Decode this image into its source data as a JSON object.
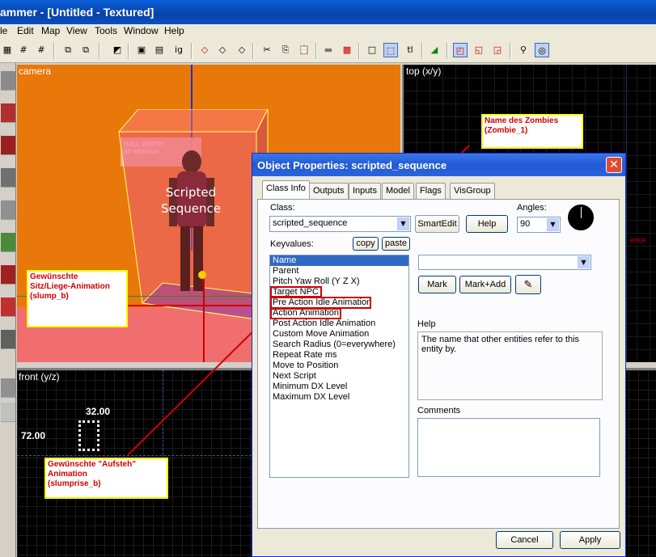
{
  "app": {
    "title": "ammer - [Untitled - Textured]"
  },
  "menu": [
    "le",
    "Edit",
    "Map",
    "View",
    "Tools",
    "Window",
    "Help"
  ],
  "toolbar": {
    "ig_label": "ig",
    "tl_label": "tl"
  },
  "viewports": {
    "camera": {
      "label": "camera",
      "scripted_text": "Scripted\nSequence",
      "sign_text": "HALL WIDTH\n84 minimum"
    },
    "top": {
      "label": "top (x/y)",
      "fragment": "ence"
    },
    "front": {
      "label": "front (y/z)",
      "width_dim": "32.00",
      "height_dim": "72.00"
    }
  },
  "callouts": {
    "name": "Name des Zombies\n(Zombie_1)",
    "sit_anim": "Gewünschte\nSitz/Liege-Animation\n(slump_b)",
    "rise_anim": "Gewünschte \"Aufsteh\"\nAnimation\n(slumprise_b)"
  },
  "dialog": {
    "title": "Object Properties: scripted_sequence",
    "close_glyph": "✕",
    "tabs": [
      "Class Info",
      "Outputs",
      "Inputs",
      "Model",
      "Flags",
      "VisGroup"
    ],
    "class_label": "Class:",
    "class_value": "scripted_sequence",
    "smartedit": "SmartEdit",
    "help_button": "Help",
    "angles_label": "Angles:",
    "angles_value": "90",
    "keyvalues_label": "Keyvalues:",
    "copy": "copy",
    "paste": "paste",
    "keyvalues": [
      "Name",
      "Parent",
      "Pitch Yaw Roll (Y Z X)",
      "Target NPC",
      "Pre Action Idle Animation",
      "Action Animation",
      "Post Action Idle Animation",
      "Custom Move Animation",
      "Search Radius (0=everywhere)",
      "Repeat Rate ms",
      "Move to Position",
      "Next Script",
      "Minimum DX Level",
      "Maximum DX Level"
    ],
    "value_field": "",
    "mark": "Mark",
    "mark_add": "Mark+Add",
    "help_label": "Help",
    "help_text": "The name that other entities refer to this entity by.",
    "comments_label": "Comments",
    "comments_value": "",
    "cancel": "Cancel",
    "apply": "Apply"
  },
  "colors": {
    "annotation_red": "#d00000",
    "annotation_yellow": "#ffff00",
    "camera_orange": "#e8780a"
  }
}
